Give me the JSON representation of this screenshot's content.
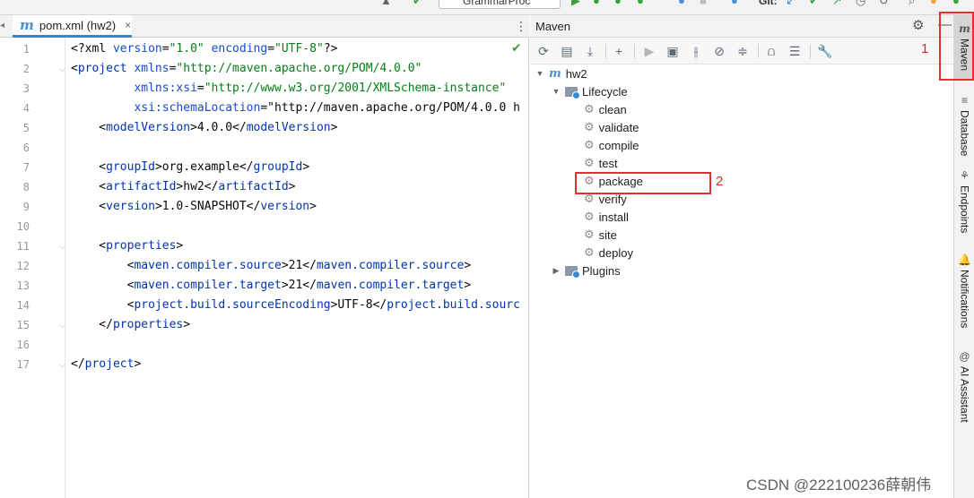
{
  "toolbar": {
    "run_config": "GrammarProc",
    "git_label": "Git:"
  },
  "editor": {
    "tab_label": "pom.xml (hw2)",
    "tab_close": "×",
    "lines": [
      {
        "n": "1",
        "code": "<?xml version=\"1.0\" encoding=\"UTF-8\"?>"
      },
      {
        "n": "2",
        "code": "<project xmlns=\"http://maven.apache.org/POM/4.0.0\""
      },
      {
        "n": "3",
        "code": "         xmlns:xsi=\"http://www.w3.org/2001/XMLSchema-instance\""
      },
      {
        "n": "4",
        "code": "         xsi:schemaLocation=\"http://maven.apache.org/POM/4.0.0 h"
      },
      {
        "n": "5",
        "code": "    <modelVersion>4.0.0</modelVersion>"
      },
      {
        "n": "6",
        "code": ""
      },
      {
        "n": "7",
        "code": "    <groupId>org.example</groupId>"
      },
      {
        "n": "8",
        "code": "    <artifactId>hw2</artifactId>"
      },
      {
        "n": "9",
        "code": "    <version>1.0-SNAPSHOT</version>"
      },
      {
        "n": "10",
        "code": ""
      },
      {
        "n": "11",
        "code": "    <properties>"
      },
      {
        "n": "12",
        "code": "        <maven.compiler.source>21</maven.compiler.source>"
      },
      {
        "n": "13",
        "code": "        <maven.compiler.target>21</maven.compiler.target>"
      },
      {
        "n": "14",
        "code": "        <project.build.sourceEncoding>UTF-8</project.build.sourc"
      },
      {
        "n": "15",
        "code": "    </properties>"
      },
      {
        "n": "16",
        "code": ""
      },
      {
        "n": "17",
        "code": "</project>"
      }
    ]
  },
  "maven": {
    "title": "Maven",
    "tree": {
      "project": "hw2",
      "lifecycle": "Lifecycle",
      "phases": [
        "clean",
        "validate",
        "compile",
        "test",
        "package",
        "verify",
        "install",
        "site",
        "deploy"
      ],
      "plugins": "Plugins"
    }
  },
  "annotations": {
    "label1": "1",
    "label2": "2"
  },
  "right_strip": {
    "tabs": [
      {
        "label": "Maven",
        "icon": "m"
      },
      {
        "label": "Database",
        "icon": "≡"
      },
      {
        "label": "Endpoints",
        "icon": "⚘"
      },
      {
        "label": "Notifications",
        "icon": "🔔"
      },
      {
        "label": "AI Assistant",
        "icon": "@"
      }
    ]
  },
  "watermark": "CSDN @222100236薛朝伟"
}
